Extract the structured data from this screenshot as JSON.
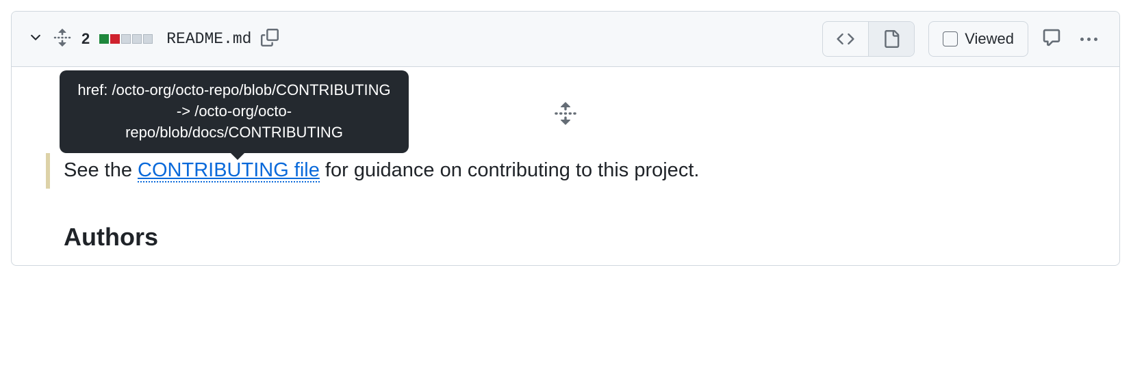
{
  "header": {
    "change_count": "2",
    "filename": "README.md",
    "viewed_label": "Viewed"
  },
  "body": {
    "tooltip_text": "href: /octo-org/octo-repo/blob/CONTRIBUTING -> /octo-org/octo-repo/blob/docs/CONTRIBUTING",
    "line_prefix": "See the ",
    "link_text": "CONTRIBUTING file",
    "line_suffix": " for guidance on contributing to this project.",
    "heading": "Authors"
  }
}
